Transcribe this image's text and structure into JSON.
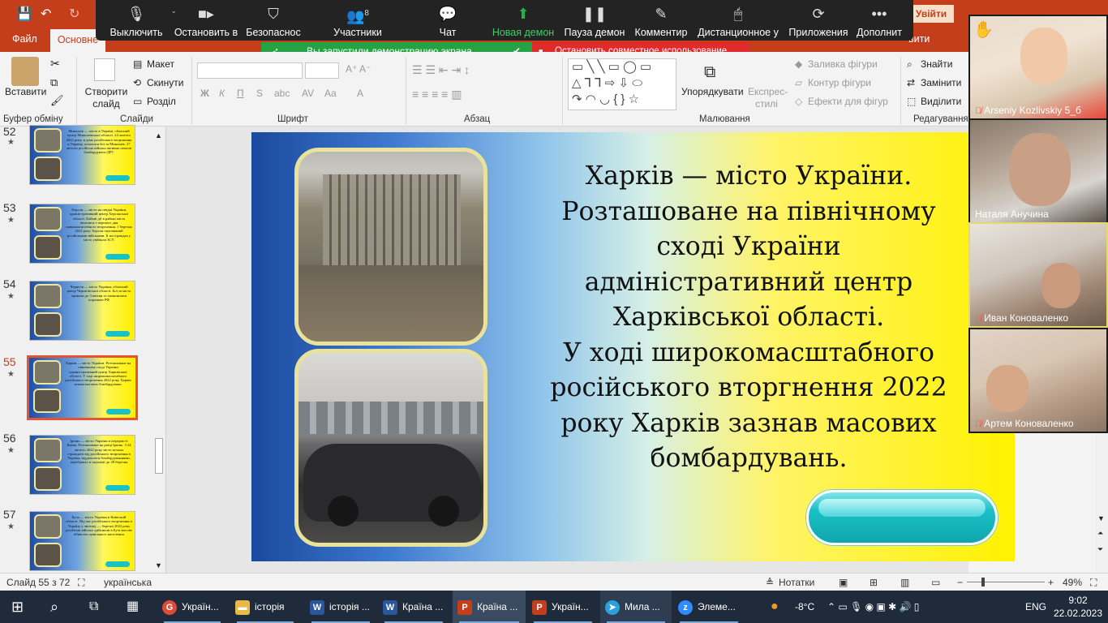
{
  "titlebar": {
    "sign_in": "Увійти"
  },
  "zoom_toolbar": {
    "mute": "Выключить",
    "stop_video": "Остановить в",
    "security": "Безопаснос",
    "participants": "Участники",
    "participants_count": "8",
    "chat": "Чат",
    "new_share": "Новая демон",
    "pause_share": "Пауза демон",
    "annotate": "Комментир",
    "remote_control": "Дистанционное у",
    "apps": "Приложения",
    "more": "Дополнит"
  },
  "share_banner": {
    "text": "Вы запустили демонстрацию экрана",
    "stop": "Остановить совместное использование"
  },
  "ribbon_tabs": {
    "file": "Файл",
    "home": "Основне",
    "view_fragment": "вити"
  },
  "ribbon": {
    "paste": "Вставити",
    "clipboard_group": "Буфер обміну",
    "new_slide": "Створити слайд",
    "layout": "Макет",
    "reset": "Скинути",
    "section": "Розділ",
    "slides_group": "Слайди",
    "font_group": "Шрифт",
    "paragraph_group": "Абзац",
    "arrange": "Упорядкувати",
    "quick_styles": "Експрес-стилі",
    "shape_fill": "Заливка фігури",
    "shape_outline": "Контур фігури",
    "shape_effects": "Ефекти для фігур",
    "drawing_group": "Малювання",
    "find": "Знайти",
    "replace": "Замінити",
    "select": "Виділити",
    "editing_group": "Редагування"
  },
  "thumbnails": [
    {
      "num": "52",
      "text": "Миколаїв — місто в Україні, обласний центр Миколаївської області. 24 лютого 2022 року, в день російського вторгнення в Україну, почалися бої за Миколаїв. 27 лютого російські війська активно почали бомбардувати ДРГ."
    },
    {
      "num": "53",
      "text": "Херсон — місто на півдні України, адміністративний центр Херсонської області. Бойові дії в районі міста почалися з першого дня повномасштабного вторгнення. 1 березня 2022 року Херсон окупований російськими військами. Її постраждав у місто увійшли ЗСУ."
    },
    {
      "num": "54",
      "text": "Чернігів — місто України, обласний центр Чернігівської області. Бої за місто тривали до 3 квітня та закінчилися поразкою РФ"
    },
    {
      "num": "55",
      "text": "Харків — місто України. Розташоване на північному сході України адміністративний центр Харківської області. У ході широкомасштабного російського вторгнення 2022 року Харків зазнав масових бомбардувань."
    },
    {
      "num": "56",
      "text": "Ірпінь — місто України в передмісті Києва. Розташоване на річці Ірпінь. З 24 лютого 2022 року місто почало страждати від російського вторгнення в Україну, відділялося бомбардуваннями, перебувало в окупації до 28 березня"
    },
    {
      "num": "57",
      "text": "Буча — місто України в Київській області. Під час російського вторгнення в Україну у лютому — березні 2022 року російські війська здійснили в Бучі масове вбивство цивільного населення"
    }
  ],
  "slide": {
    "lines": [
      "Харків — місто України.",
      "Розташоване на північному",
      "сході України",
      "адміністративний центр",
      "Харківської області.",
      "У ході широкомасштабного",
      "російського вторгнення 2022",
      "року Харків зазнав масових",
      "бомбардувань."
    ]
  },
  "participants": [
    {
      "name": "Arseniy Kozlivskiy 5_б"
    },
    {
      "name": "Наталя Анучина"
    },
    {
      "name": "Иван Коноваленко"
    },
    {
      "name": "Артем Коноваленко"
    }
  ],
  "statusbar": {
    "slide_info": "Слайд 55 з 72",
    "language": "українська",
    "notes": "Нотатки",
    "zoom": "49%"
  },
  "taskbar": {
    "items": [
      {
        "label": "Україн...",
        "color": "#dd4b39",
        "glyph": "G"
      },
      {
        "label": "історія",
        "color": "#e8b84a",
        "glyph": "▬"
      },
      {
        "label": "історія ...",
        "color": "#2b579a",
        "glyph": "W"
      },
      {
        "label": "Країна ...",
        "color": "#2b579a",
        "glyph": "W"
      },
      {
        "label": "Країна ...",
        "color": "#c43e1c",
        "glyph": "P"
      },
      {
        "label": "Україн...",
        "color": "#c43e1c",
        "glyph": "P"
      },
      {
        "label": "Мила ...",
        "color": "#2aa1da",
        "glyph": "➤"
      },
      {
        "label": "Элеме...",
        "color": "#2d8cff",
        "glyph": "z"
      }
    ],
    "weather": "-8°C",
    "lang": "ENG",
    "time": "9:02",
    "date": "22.02.2023"
  }
}
